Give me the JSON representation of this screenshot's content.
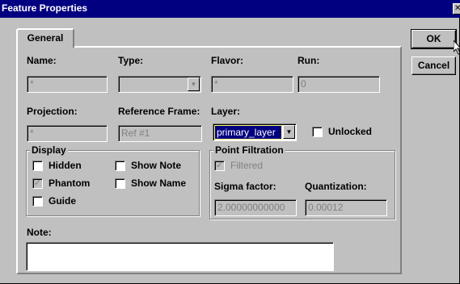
{
  "window": {
    "title": "Feature Properties",
    "close_glyph": "✕"
  },
  "tabs": [
    {
      "label": "General"
    }
  ],
  "fields": {
    "name": {
      "label": "Name:",
      "value": "*"
    },
    "type": {
      "label": "Type:",
      "value": ""
    },
    "flavor": {
      "label": "Flavor:",
      "value": "*"
    },
    "run": {
      "label": "Run:",
      "value": "0"
    },
    "projection": {
      "label": "Projection:",
      "value": "*"
    },
    "reference_frame": {
      "label": "Reference Frame:",
      "value": "Ref #1"
    },
    "layer": {
      "label": "Layer:",
      "value": "primary_layer"
    }
  },
  "unlocked": {
    "label": "Unlocked",
    "checked": false
  },
  "display": {
    "title": "Display",
    "hidden": {
      "label": "Hidden",
      "checked": false
    },
    "phantom": {
      "label": "Phantom",
      "checked": true
    },
    "guide": {
      "label": "Guide",
      "checked": false
    },
    "show_note": {
      "label": "Show Note",
      "checked": false
    },
    "show_name": {
      "label": "Show Name",
      "checked": false
    }
  },
  "point_filtration": {
    "title": "Point Filtration",
    "filtered": {
      "label": "Filtered",
      "checked": true
    },
    "sigma_factor": {
      "label": "Sigma factor:",
      "value": "2.00000000000"
    },
    "quantization": {
      "label": "Quantization:",
      "value": "0.00012"
    }
  },
  "note": {
    "label": "Note:",
    "value": ""
  },
  "buttons": {
    "ok": "OK",
    "cancel": "Cancel"
  },
  "glyphs": {
    "check": "✓",
    "dropdown": "▼"
  }
}
